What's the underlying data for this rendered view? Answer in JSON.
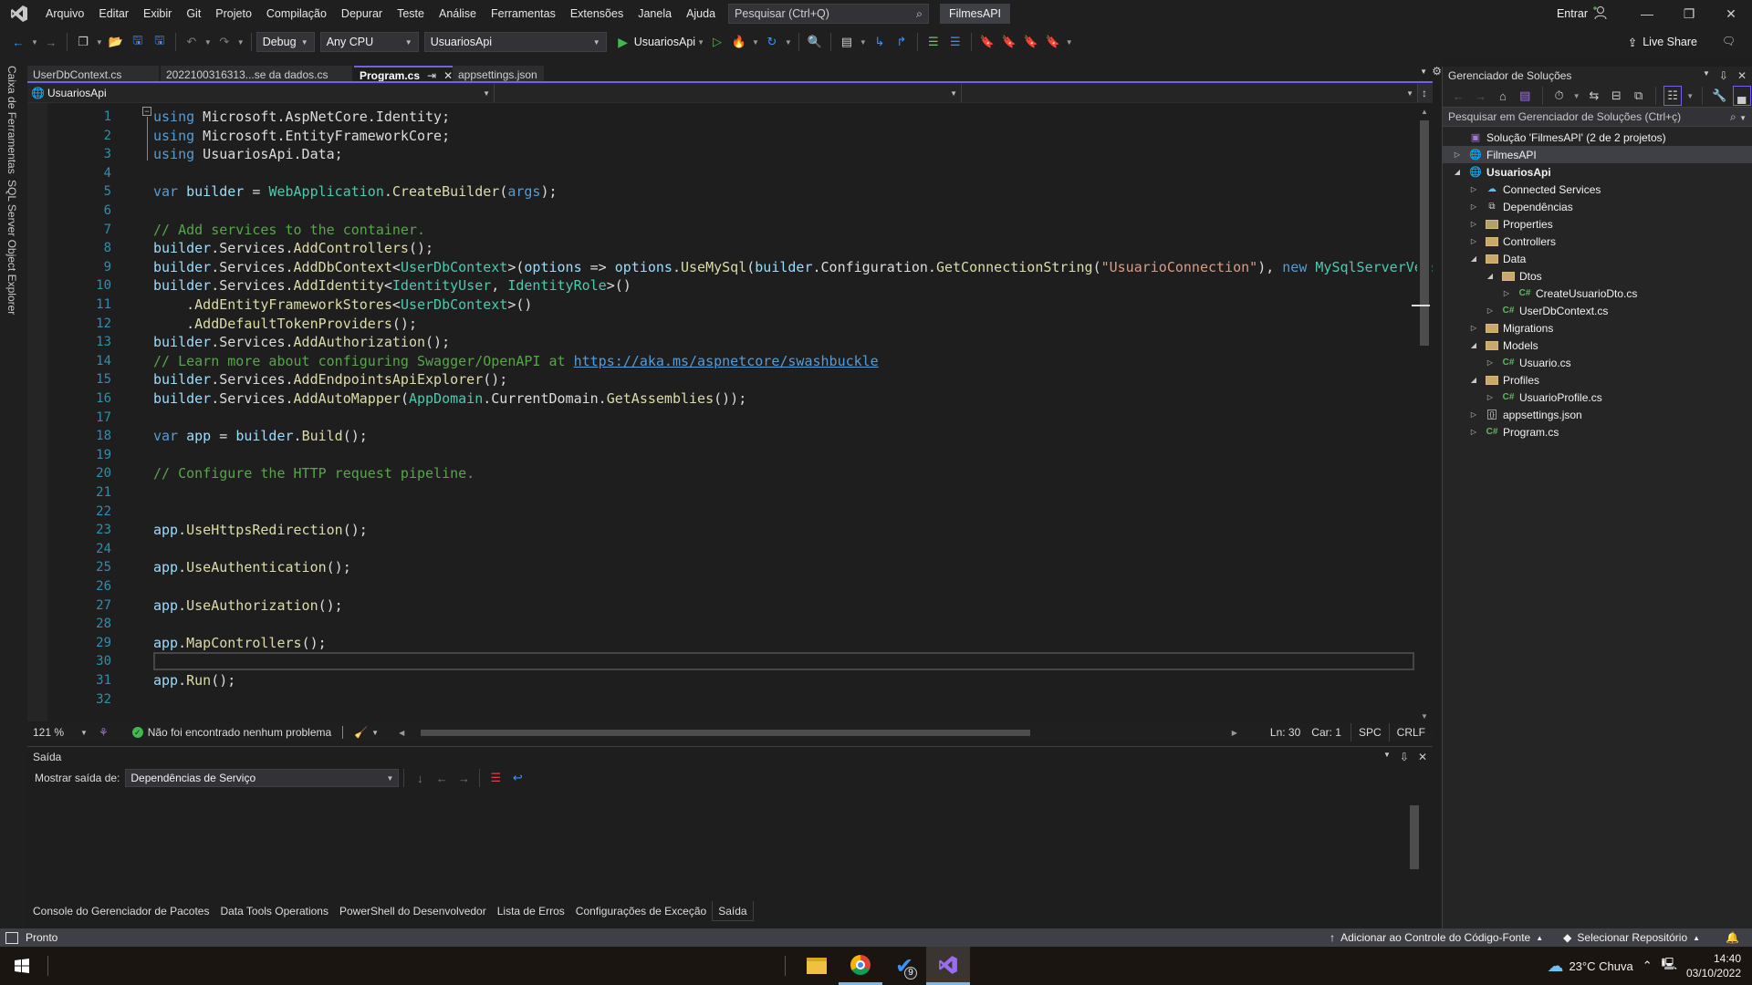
{
  "titlebar": {
    "menu": [
      "Arquivo",
      "Editar",
      "Exibir",
      "Git",
      "Projeto",
      "Compilação",
      "Depurar",
      "Teste",
      "Análise",
      "Ferramentas",
      "Extensões",
      "Janela",
      "Ajuda"
    ],
    "search_placeholder": "Pesquisar (Ctrl+Q)",
    "solution_name": "FilmesAPI",
    "sign_in": "Entrar"
  },
  "toolbar": {
    "configuration": "Debug",
    "platform": "Any CPU",
    "startup_project": "UsuariosApi",
    "run_target": "UsuariosApi",
    "live_share": "Live Share"
  },
  "left_rail": [
    "Caixa de Ferramentas",
    "SQL Server Object Explorer"
  ],
  "doc_tabs": [
    {
      "label": "UserDbContext.cs",
      "active": false
    },
    {
      "label": "2022100316313...se da dados.cs",
      "active": false
    },
    {
      "label": "Program.cs",
      "active": true
    },
    {
      "label": "appsettings.json",
      "active": false
    }
  ],
  "navbar": {
    "project": "UsuariosApi"
  },
  "editor": {
    "current_line": 30,
    "lines": [
      {
        "n": "1",
        "segs": [
          [
            "kw",
            "using"
          ],
          [
            "pl",
            " Microsoft.AspNetCore.Identity;"
          ]
        ]
      },
      {
        "n": "2",
        "segs": [
          [
            "kw",
            "using"
          ],
          [
            "pl",
            " Microsoft.EntityFrameworkCore;"
          ]
        ]
      },
      {
        "n": "3",
        "segs": [
          [
            "kw",
            "using"
          ],
          [
            "pl",
            " UsuariosApi.Data;"
          ]
        ]
      },
      {
        "n": "4",
        "segs": []
      },
      {
        "n": "5",
        "segs": [
          [
            "kw",
            "var"
          ],
          [
            "pl",
            " "
          ],
          [
            "id",
            "builder"
          ],
          [
            "pl",
            " = "
          ],
          [
            "ty",
            "WebApplication"
          ],
          [
            "pl",
            "."
          ],
          [
            "me",
            "CreateBuilder"
          ],
          [
            "pl",
            "("
          ],
          [
            "kw",
            "args"
          ],
          [
            "pl",
            ");"
          ]
        ]
      },
      {
        "n": "6",
        "segs": []
      },
      {
        "n": "7",
        "segs": [
          [
            "cm",
            "// Add services to the container."
          ]
        ]
      },
      {
        "n": "8",
        "segs": [
          [
            "id",
            "builder"
          ],
          [
            "pl",
            "."
          ],
          [
            "pl",
            "Services"
          ],
          [
            "pl",
            "."
          ],
          [
            "me",
            "AddControllers"
          ],
          [
            "pl",
            "();"
          ]
        ]
      },
      {
        "n": "9",
        "segs": [
          [
            "id",
            "builder"
          ],
          [
            "pl",
            ".Services."
          ],
          [
            "me",
            "AddDbContext"
          ],
          [
            "pl",
            "<"
          ],
          [
            "ty",
            "UserDbContext"
          ],
          [
            "pl",
            ">("
          ],
          [
            "id",
            "options"
          ],
          [
            "pl",
            " => "
          ],
          [
            "id",
            "options"
          ],
          [
            "pl",
            "."
          ],
          [
            "me",
            "UseMySql"
          ],
          [
            "pl",
            "("
          ],
          [
            "id",
            "builder"
          ],
          [
            "pl",
            ".Configuration."
          ],
          [
            "me",
            "GetConnectionString"
          ],
          [
            "pl",
            "("
          ],
          [
            "st",
            "\"UsuarioConnection\""
          ],
          [
            "pl",
            "), "
          ],
          [
            "kw",
            "new"
          ],
          [
            "pl",
            " "
          ],
          [
            "ty",
            "MySqlServerVersion"
          ]
        ]
      },
      {
        "n": "10",
        "segs": [
          [
            "id",
            "builder"
          ],
          [
            "pl",
            ".Services."
          ],
          [
            "me",
            "AddIdentity"
          ],
          [
            "pl",
            "<"
          ],
          [
            "ty",
            "IdentityUser"
          ],
          [
            "pl",
            ", "
          ],
          [
            "ty",
            "IdentityRole"
          ],
          [
            "pl",
            ">()"
          ]
        ]
      },
      {
        "n": "11",
        "segs": [
          [
            "pl",
            "    ."
          ],
          [
            "me",
            "AddEntityFrameworkStores"
          ],
          [
            "pl",
            "<"
          ],
          [
            "ty",
            "UserDbContext"
          ],
          [
            "pl",
            ">()"
          ]
        ]
      },
      {
        "n": "12",
        "segs": [
          [
            "pl",
            "    ."
          ],
          [
            "me",
            "AddDefaultTokenProviders"
          ],
          [
            "pl",
            "();"
          ]
        ]
      },
      {
        "n": "13",
        "segs": [
          [
            "id",
            "builder"
          ],
          [
            "pl",
            ".Services."
          ],
          [
            "me",
            "AddAuthorization"
          ],
          [
            "pl",
            "();"
          ]
        ]
      },
      {
        "n": "14",
        "segs": [
          [
            "cm",
            "// Learn more about configuring Swagger/OpenAPI at "
          ],
          [
            "lk",
            "https://aka.ms/aspnetcore/swashbuckle"
          ]
        ]
      },
      {
        "n": "15",
        "segs": [
          [
            "id",
            "builder"
          ],
          [
            "pl",
            ".Services."
          ],
          [
            "me",
            "AddEndpointsApiExplorer"
          ],
          [
            "pl",
            "();"
          ]
        ]
      },
      {
        "n": "16",
        "segs": [
          [
            "id",
            "builder"
          ],
          [
            "pl",
            ".Services."
          ],
          [
            "me",
            "AddAutoMapper"
          ],
          [
            "pl",
            "("
          ],
          [
            "ty",
            "AppDomain"
          ],
          [
            "pl",
            ".CurrentDomain."
          ],
          [
            "me",
            "GetAssemblies"
          ],
          [
            "pl",
            "());"
          ]
        ]
      },
      {
        "n": "17",
        "segs": []
      },
      {
        "n": "18",
        "segs": [
          [
            "kw",
            "var"
          ],
          [
            "pl",
            " "
          ],
          [
            "id",
            "app"
          ],
          [
            "pl",
            " = "
          ],
          [
            "id",
            "builder"
          ],
          [
            "pl",
            "."
          ],
          [
            "me",
            "Build"
          ],
          [
            "pl",
            "();"
          ]
        ]
      },
      {
        "n": "19",
        "segs": []
      },
      {
        "n": "20",
        "segs": [
          [
            "cm",
            "// Configure the HTTP request pipeline."
          ]
        ]
      },
      {
        "n": "21",
        "segs": []
      },
      {
        "n": "22",
        "segs": []
      },
      {
        "n": "23",
        "segs": [
          [
            "id",
            "app"
          ],
          [
            "pl",
            "."
          ],
          [
            "me",
            "UseHttpsRedirection"
          ],
          [
            "pl",
            "();"
          ]
        ]
      },
      {
        "n": "24",
        "segs": []
      },
      {
        "n": "25",
        "segs": [
          [
            "id",
            "app"
          ],
          [
            "pl",
            "."
          ],
          [
            "me",
            "UseAuthentication"
          ],
          [
            "pl",
            "();"
          ]
        ]
      },
      {
        "n": "26",
        "segs": []
      },
      {
        "n": "27",
        "segs": [
          [
            "id",
            "app"
          ],
          [
            "pl",
            "."
          ],
          [
            "me",
            "UseAuthorization"
          ],
          [
            "pl",
            "();"
          ]
        ]
      },
      {
        "n": "28",
        "segs": []
      },
      {
        "n": "29",
        "segs": [
          [
            "id",
            "app"
          ],
          [
            "pl",
            "."
          ],
          [
            "me",
            "MapControllers"
          ],
          [
            "pl",
            "();"
          ]
        ]
      },
      {
        "n": "30",
        "segs": []
      },
      {
        "n": "31",
        "segs": [
          [
            "id",
            "app"
          ],
          [
            "pl",
            "."
          ],
          [
            "me",
            "Run"
          ],
          [
            "pl",
            "();"
          ]
        ]
      },
      {
        "n": "32",
        "segs": []
      }
    ]
  },
  "editor_status": {
    "zoom": "121 %",
    "issues": "Não foi encontrado nenhum problema",
    "line": "Ln: 30",
    "col": "Car: 1",
    "whitespace": "SPC",
    "line_ending": "CRLF"
  },
  "output": {
    "title": "Saída",
    "show_from_label": "Mostrar saída de:",
    "source": "Dependências de Serviço"
  },
  "bottom_tabs": [
    {
      "label": "Console do Gerenciador de Pacotes",
      "active": false
    },
    {
      "label": "Data Tools Operations",
      "active": false
    },
    {
      "label": "PowerShell do Desenvolvedor",
      "active": false
    },
    {
      "label": "Lista de Erros",
      "active": false
    },
    {
      "label": "Configurações de Exceção",
      "active": false
    },
    {
      "label": "Saída",
      "active": true
    }
  ],
  "solution_explorer": {
    "title": "Gerenciador de Soluções",
    "search_placeholder": "Pesquisar em Gerenciador de Soluções (Ctrl+ç)",
    "items": [
      {
        "label": "Solução 'FilmesAPI' (2 de 2 projetos)",
        "depth": 0,
        "twisty": "",
        "icon": "solution"
      },
      {
        "label": "FilmesAPI",
        "depth": 0,
        "twisty": "collapsed",
        "icon": "project",
        "selected": true
      },
      {
        "label": "UsuariosApi",
        "depth": 0,
        "twisty": "expanded",
        "icon": "project",
        "bold": true
      },
      {
        "label": "Connected Services",
        "depth": 1,
        "twisty": "collapsed",
        "icon": "connected"
      },
      {
        "label": "Dependências",
        "depth": 1,
        "twisty": "collapsed",
        "icon": "deps"
      },
      {
        "label": "Properties",
        "depth": 1,
        "twisty": "collapsed",
        "icon": "props"
      },
      {
        "label": "Controllers",
        "depth": 1,
        "twisty": "collapsed",
        "icon": "folder"
      },
      {
        "label": "Data",
        "depth": 1,
        "twisty": "expanded",
        "icon": "folder"
      },
      {
        "label": "Dtos",
        "depth": 2,
        "twisty": "expanded",
        "icon": "folder"
      },
      {
        "label": "CreateUsuarioDto.cs",
        "depth": 3,
        "twisty": "collapsed",
        "icon": "cs"
      },
      {
        "label": "UserDbContext.cs",
        "depth": 2,
        "twisty": "collapsed",
        "icon": "cs"
      },
      {
        "label": "Migrations",
        "depth": 1,
        "twisty": "collapsed",
        "icon": "folder"
      },
      {
        "label": "Models",
        "depth": 1,
        "twisty": "expanded",
        "icon": "folder"
      },
      {
        "label": "Usuario.cs",
        "depth": 2,
        "twisty": "collapsed",
        "icon": "cs"
      },
      {
        "label": "Profiles",
        "depth": 1,
        "twisty": "expanded",
        "icon": "folder"
      },
      {
        "label": "UsuarioProfile.cs",
        "depth": 2,
        "twisty": "collapsed",
        "icon": "cs"
      },
      {
        "label": "appsettings.json",
        "depth": 1,
        "twisty": "collapsed",
        "icon": "json"
      },
      {
        "label": "Program.cs",
        "depth": 1,
        "twisty": "collapsed",
        "icon": "cs"
      }
    ]
  },
  "statusbar": {
    "state": "Pronto",
    "source_control": "Adicionar ao Controle do Código-Fonte",
    "repository": "Selecionar Repositório"
  },
  "taskbar": {
    "todo_badge": "9",
    "weather": "23°C  Chuva",
    "time": "14:40",
    "date": "03/10/2022"
  },
  "colors": {
    "accent": "#7160e8",
    "keyword": "#569cd6",
    "type": "#4ec9b0",
    "method": "#dcdcaa",
    "comment": "#57a64a",
    "string": "#d69d85",
    "line_number": "#2b91af"
  }
}
